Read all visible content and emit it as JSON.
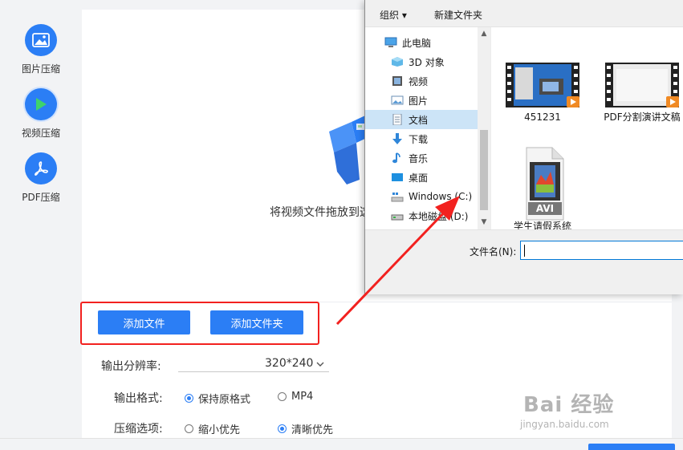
{
  "sidebar": {
    "items": [
      {
        "label": "图片压缩",
        "icon": "image-icon"
      },
      {
        "label": "视频压缩",
        "icon": "play-icon"
      },
      {
        "label": "PDF压缩",
        "icon": "pdf-icon"
      }
    ]
  },
  "drop_zone": {
    "text": "将视频文件拖放到这"
  },
  "buttons": {
    "add_file": "添加文件",
    "add_folder": "添加文件夹"
  },
  "options": {
    "resolution_label": "输出分辨率:",
    "resolution_value": "320*240",
    "format_label": "输出格式:",
    "format_options": [
      {
        "label": "保持原格式",
        "selected": true
      },
      {
        "label": "MP4",
        "selected": false
      }
    ],
    "compress_label": "压缩选项:",
    "compress_options": [
      {
        "label": "缩小优先",
        "selected": false
      },
      {
        "label": "清晰优先",
        "selected": true
      }
    ]
  },
  "dialog": {
    "toolbar": {
      "organize": "组织 ▾",
      "new_folder": "新建文件夹"
    },
    "nav": [
      {
        "label": "此电脑",
        "icon": "pc-icon",
        "selected": false
      },
      {
        "label": "3D 对象",
        "icon": "cube-icon",
        "selected": false
      },
      {
        "label": "视频",
        "icon": "video-icon",
        "selected": false
      },
      {
        "label": "图片",
        "icon": "picture-icon",
        "selected": false
      },
      {
        "label": "文档",
        "icon": "document-icon",
        "selected": true
      },
      {
        "label": "下载",
        "icon": "download-icon",
        "selected": false
      },
      {
        "label": "音乐",
        "icon": "music-icon",
        "selected": false
      },
      {
        "label": "桌面",
        "icon": "desktop-icon",
        "selected": false
      },
      {
        "label": "Windows (C:)",
        "icon": "drive-icon",
        "selected": false
      },
      {
        "label": "本地磁盘 (D:)",
        "icon": "drive-icon",
        "selected": false
      }
    ],
    "files": [
      {
        "name": "451231",
        "type": "video-thumb"
      },
      {
        "name": "PDF分割演讲文稿",
        "type": "video-thumb"
      },
      {
        "name": "学生请假系统",
        "type": "avi-file",
        "badge": "AVI"
      }
    ],
    "filename_label": "文件名(N):",
    "filename_value": ""
  },
  "watermark": {
    "top": "Bai 经验",
    "bottom": "jingyan.baidu.com"
  },
  "colors": {
    "accent": "#2b7ef5",
    "highlight_red": "#f2211f",
    "nav_selected": "#cce4f7"
  }
}
